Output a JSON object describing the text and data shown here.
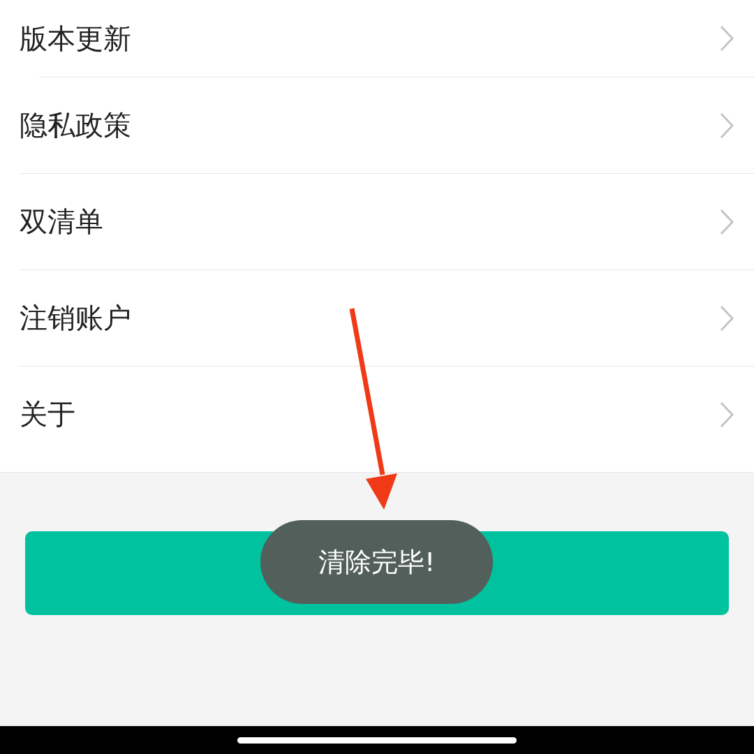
{
  "menu_items": [
    {
      "label": "版本更新"
    },
    {
      "label": "隐私政策"
    },
    {
      "label": "双清单"
    },
    {
      "label": "注销账户"
    },
    {
      "label": "关于"
    }
  ],
  "logout_button": {
    "kind": "button"
  },
  "toast": {
    "message": "清除完毕!"
  },
  "annotation": {
    "kind": "arrow"
  }
}
